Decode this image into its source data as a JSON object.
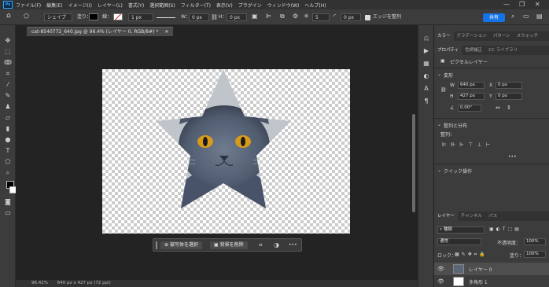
{
  "menu": {
    "logo": "Ps",
    "items": [
      "ファイル(F)",
      "編集(E)",
      "イメージ(I)",
      "レイヤー(L)",
      "書式(Y)",
      "選択範囲(S)",
      "フィルター(T)",
      "表示(V)",
      "プラグイン",
      "ウィンドウ(W)",
      "ヘルプ(H)"
    ],
    "window_controls": [
      "—",
      "❐",
      "✕"
    ]
  },
  "options": {
    "tool_mode": "シェイプ",
    "fill_label": "塗り：",
    "stroke_label": "線：",
    "stroke_width": "1 px",
    "w_label": "W：",
    "w_value": "0 px",
    "h_label": "H：",
    "h_value": "0 px",
    "corner_value": "5",
    "radius_value": "0 px",
    "align_edges_label": "エッジを整列",
    "share_label": "共有",
    "accent_color": "#1473e6"
  },
  "document": {
    "tab_title": "cat-8540772_640.jpg @ 96.4% (レイヤー 0, RGB/8#) *",
    "close_icon": "✕",
    "zoom": "96.42%",
    "dimensions": "640 px x 427 px (72 ppi)"
  },
  "contextbar": {
    "select_subject": "被写体を選択",
    "remove_bg": "背景を削除",
    "more": "•••"
  },
  "panels": {
    "top_tabs": [
      "カラー",
      "グラデーション",
      "パターン",
      "スウォッチ"
    ],
    "prop_tabs": [
      "プロパティ",
      "色調補正",
      "CC ライブラリ"
    ],
    "prop_type": "ピクセルレイヤー",
    "transform_title": "変形",
    "w": "640 px",
    "h": "427 px",
    "x": "0 px",
    "y": "0 px",
    "angle": "0.00°",
    "w_label": "W",
    "h_label": "H",
    "x_label": "X",
    "y_label": "Y",
    "align_title": "整列と分布",
    "align_sub": "整列：",
    "quick_title": "クイック操作",
    "layer_tabs": [
      "レイヤー",
      "チャンネル",
      "パス"
    ],
    "kind_label": "種類",
    "blend_mode": "通常",
    "opacity_label": "不透明度：",
    "opacity_value": "100%",
    "lock_label": "ロック：",
    "fill_label": "塗り：",
    "fill_value": "100%",
    "layers": [
      {
        "name": "レイヤー 0",
        "selected": true
      },
      {
        "name": "多角形 1",
        "selected": false
      }
    ]
  }
}
